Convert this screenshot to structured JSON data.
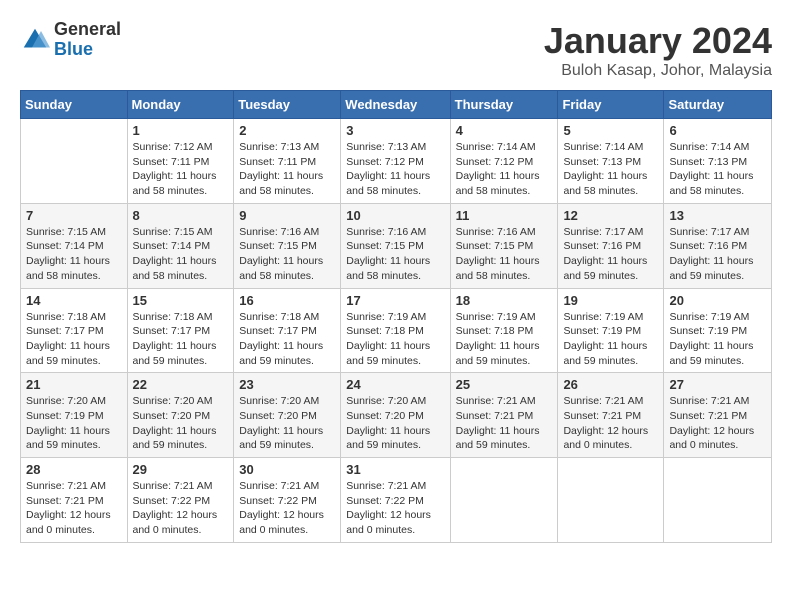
{
  "header": {
    "logo_general": "General",
    "logo_blue": "Blue",
    "month_title": "January 2024",
    "location": "Buloh Kasap, Johor, Malaysia"
  },
  "days_of_week": [
    "Sunday",
    "Monday",
    "Tuesday",
    "Wednesday",
    "Thursday",
    "Friday",
    "Saturday"
  ],
  "weeks": [
    [
      {
        "day": "",
        "info": ""
      },
      {
        "day": "1",
        "info": "Sunrise: 7:12 AM\nSunset: 7:11 PM\nDaylight: 11 hours and 58 minutes."
      },
      {
        "day": "2",
        "info": "Sunrise: 7:13 AM\nSunset: 7:11 PM\nDaylight: 11 hours and 58 minutes."
      },
      {
        "day": "3",
        "info": "Sunrise: 7:13 AM\nSunset: 7:12 PM\nDaylight: 11 hours and 58 minutes."
      },
      {
        "day": "4",
        "info": "Sunrise: 7:14 AM\nSunset: 7:12 PM\nDaylight: 11 hours and 58 minutes."
      },
      {
        "day": "5",
        "info": "Sunrise: 7:14 AM\nSunset: 7:13 PM\nDaylight: 11 hours and 58 minutes."
      },
      {
        "day": "6",
        "info": "Sunrise: 7:14 AM\nSunset: 7:13 PM\nDaylight: 11 hours and 58 minutes."
      }
    ],
    [
      {
        "day": "7",
        "info": "Sunrise: 7:15 AM\nSunset: 7:14 PM\nDaylight: 11 hours and 58 minutes."
      },
      {
        "day": "8",
        "info": "Sunrise: 7:15 AM\nSunset: 7:14 PM\nDaylight: 11 hours and 58 minutes."
      },
      {
        "day": "9",
        "info": "Sunrise: 7:16 AM\nSunset: 7:15 PM\nDaylight: 11 hours and 58 minutes."
      },
      {
        "day": "10",
        "info": "Sunrise: 7:16 AM\nSunset: 7:15 PM\nDaylight: 11 hours and 58 minutes."
      },
      {
        "day": "11",
        "info": "Sunrise: 7:16 AM\nSunset: 7:15 PM\nDaylight: 11 hours and 58 minutes."
      },
      {
        "day": "12",
        "info": "Sunrise: 7:17 AM\nSunset: 7:16 PM\nDaylight: 11 hours and 59 minutes."
      },
      {
        "day": "13",
        "info": "Sunrise: 7:17 AM\nSunset: 7:16 PM\nDaylight: 11 hours and 59 minutes."
      }
    ],
    [
      {
        "day": "14",
        "info": "Sunrise: 7:18 AM\nSunset: 7:17 PM\nDaylight: 11 hours and 59 minutes."
      },
      {
        "day": "15",
        "info": "Sunrise: 7:18 AM\nSunset: 7:17 PM\nDaylight: 11 hours and 59 minutes."
      },
      {
        "day": "16",
        "info": "Sunrise: 7:18 AM\nSunset: 7:17 PM\nDaylight: 11 hours and 59 minutes."
      },
      {
        "day": "17",
        "info": "Sunrise: 7:19 AM\nSunset: 7:18 PM\nDaylight: 11 hours and 59 minutes."
      },
      {
        "day": "18",
        "info": "Sunrise: 7:19 AM\nSunset: 7:18 PM\nDaylight: 11 hours and 59 minutes."
      },
      {
        "day": "19",
        "info": "Sunrise: 7:19 AM\nSunset: 7:19 PM\nDaylight: 11 hours and 59 minutes."
      },
      {
        "day": "20",
        "info": "Sunrise: 7:19 AM\nSunset: 7:19 PM\nDaylight: 11 hours and 59 minutes."
      }
    ],
    [
      {
        "day": "21",
        "info": "Sunrise: 7:20 AM\nSunset: 7:19 PM\nDaylight: 11 hours and 59 minutes."
      },
      {
        "day": "22",
        "info": "Sunrise: 7:20 AM\nSunset: 7:20 PM\nDaylight: 11 hours and 59 minutes."
      },
      {
        "day": "23",
        "info": "Sunrise: 7:20 AM\nSunset: 7:20 PM\nDaylight: 11 hours and 59 minutes."
      },
      {
        "day": "24",
        "info": "Sunrise: 7:20 AM\nSunset: 7:20 PM\nDaylight: 11 hours and 59 minutes."
      },
      {
        "day": "25",
        "info": "Sunrise: 7:21 AM\nSunset: 7:21 PM\nDaylight: 11 hours and 59 minutes."
      },
      {
        "day": "26",
        "info": "Sunrise: 7:21 AM\nSunset: 7:21 PM\nDaylight: 12 hours and 0 minutes."
      },
      {
        "day": "27",
        "info": "Sunrise: 7:21 AM\nSunset: 7:21 PM\nDaylight: 12 hours and 0 minutes."
      }
    ],
    [
      {
        "day": "28",
        "info": "Sunrise: 7:21 AM\nSunset: 7:21 PM\nDaylight: 12 hours and 0 minutes."
      },
      {
        "day": "29",
        "info": "Sunrise: 7:21 AM\nSunset: 7:22 PM\nDaylight: 12 hours and 0 minutes."
      },
      {
        "day": "30",
        "info": "Sunrise: 7:21 AM\nSunset: 7:22 PM\nDaylight: 12 hours and 0 minutes."
      },
      {
        "day": "31",
        "info": "Sunrise: 7:21 AM\nSunset: 7:22 PM\nDaylight: 12 hours and 0 minutes."
      },
      {
        "day": "",
        "info": ""
      },
      {
        "day": "",
        "info": ""
      },
      {
        "day": "",
        "info": ""
      }
    ]
  ]
}
